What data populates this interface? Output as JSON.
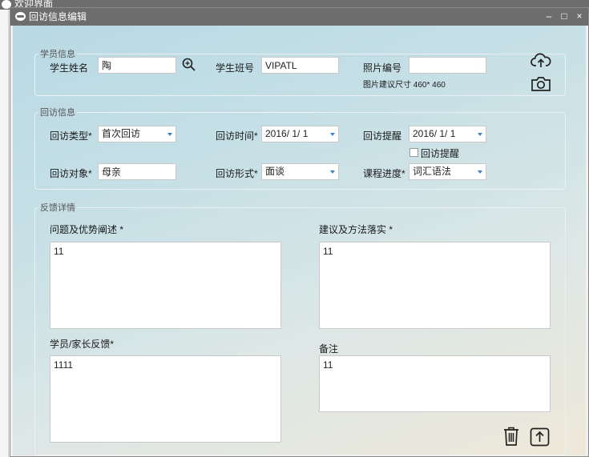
{
  "bg_window": {
    "title": "欢迎界面"
  },
  "dialog": {
    "title": "回访信息编辑",
    "controls": {
      "minimize": "–",
      "maximize": "□",
      "close": "×"
    }
  },
  "student_info": {
    "legend": "学员信息",
    "name_label": "学生姓名",
    "name_value": "陶",
    "class_label": "学生班号",
    "class_value": "VIPATL",
    "photo_label": "照片编号",
    "photo_value": "",
    "photo_hint": "图片建议尺寸 460* 460"
  },
  "visit_info": {
    "legend": "回访信息",
    "type_label": "回访类型*",
    "type_value": "首次回访",
    "time_label": "回访时间*",
    "time_value": "2016/  1/  1",
    "remind_label": "回访提醒",
    "remind_value": "2016/  1/  1",
    "remind_checkbox_label": "回访提醒",
    "target_label": "回访对象*",
    "target_value": "母亲",
    "form_label": "回访形式*",
    "form_value": "面谈",
    "progress_label": "课程进度*",
    "progress_value": "词汇语法"
  },
  "feedback": {
    "legend": "反馈详情",
    "problem_label": "问题及优势阐述 *",
    "problem_value": "11",
    "suggest_label": "建议及方法落实 *",
    "suggest_value": "11",
    "parent_label": "学员/家长反馈*",
    "parent_value": "1111",
    "remark_label": "备注",
    "remark_value": "11"
  },
  "icons": {
    "search": "search-icon",
    "upload": "cloud-upload-icon",
    "camera": "camera-icon",
    "delete": "trash-icon",
    "submit": "upload-arrow-icon"
  },
  "colors": {
    "titlebar": "#6d6d6d",
    "accent": "#3b83c9"
  }
}
